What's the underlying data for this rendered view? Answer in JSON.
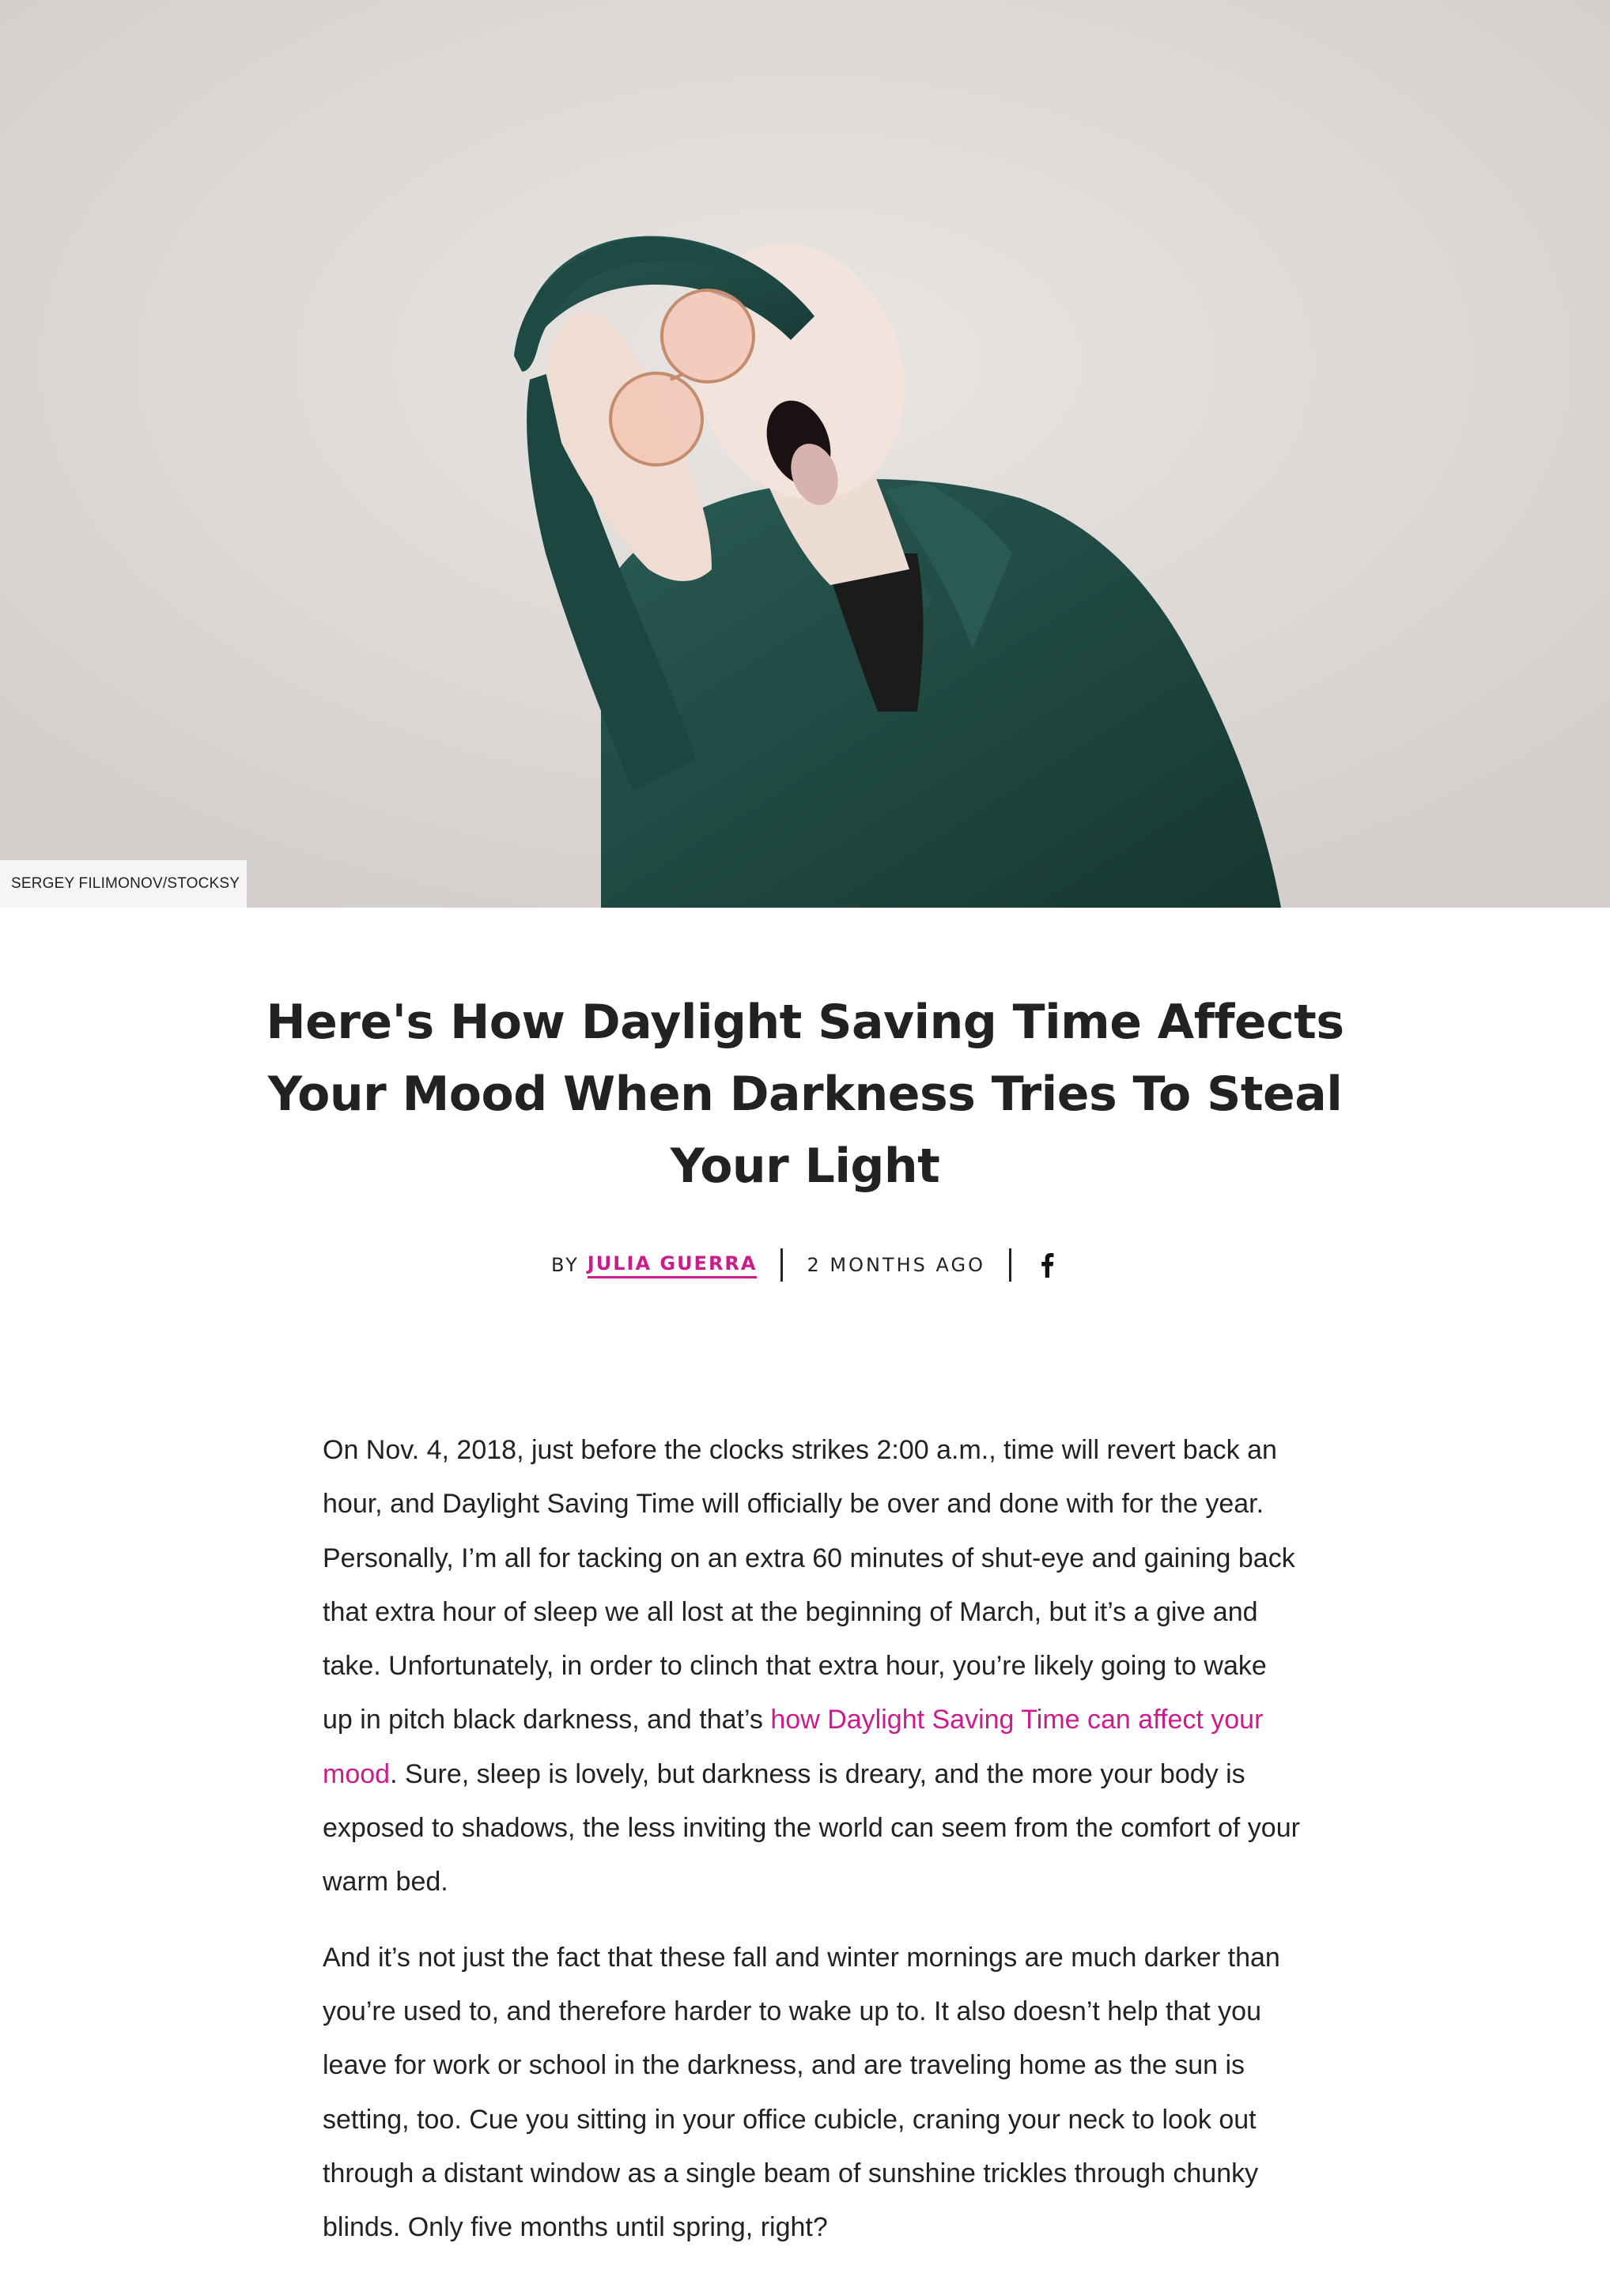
{
  "hero": {
    "credit": "SERGEY FILIMONOV/STOCKSY"
  },
  "article": {
    "title": "Here's How Daylight Saving Time Affects Your Mood When Darkness Tries To Steal Your Light",
    "byline": {
      "by_label": "BY",
      "author": "JULIA GUERRA",
      "time_ago": "2 MONTHS AGO",
      "share_icon": "facebook-icon"
    },
    "paragraph1": {
      "before_link": "On Nov. 4, 2018, just before the clocks strikes 2:00 a.m., time will revert back an hour, and Daylight Saving Time will officially be over and done with for the year. Personally, I’m all for tacking on an extra 60 minutes of shut-eye and gaining back that extra hour of sleep we all lost at the beginning of March, but it’s a give and take. Unfortunately, in order to clinch that extra hour, you’re likely going to wake up in pitch black darkness, and that’s ",
      "link_text": "how Daylight Saving Time can affect your mood",
      "after_link": ". Sure, sleep is lovely, but darkness is dreary, and the more your body is exposed to shadows, the less inviting the world can seem from the comfort of your warm bed."
    },
    "paragraph2": "And it’s not just the fact that these fall and winter mornings are much darker than you’re used to, and therefore harder to wake up to. It also doesn’t help that you leave for work or school in the darkness, and are traveling home as the sun is setting, too. Cue you sitting in your office cubicle, craning your neck to look out through a distant window as a single beam of sunshine trickles through chunky blinds. Only five months until spring, right?"
  },
  "colors": {
    "accent": "#cc1c8c",
    "text": "#222222",
    "coat": "#1f4a45",
    "background": "#e2dfdd"
  }
}
